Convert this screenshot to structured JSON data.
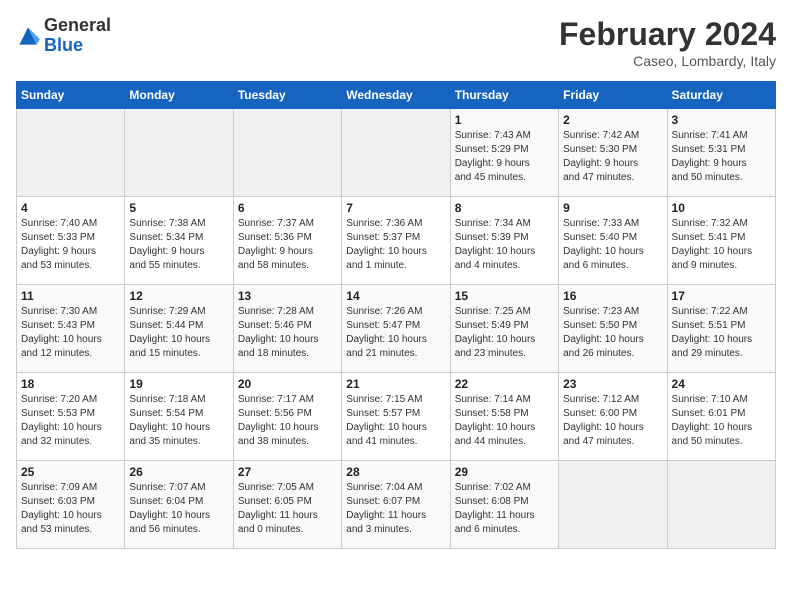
{
  "header": {
    "logo_general": "General",
    "logo_blue": "Blue",
    "month_title": "February 2024",
    "location": "Caseo, Lombardy, Italy"
  },
  "days_of_week": [
    "Sunday",
    "Monday",
    "Tuesday",
    "Wednesday",
    "Thursday",
    "Friday",
    "Saturday"
  ],
  "weeks": [
    [
      {
        "num": "",
        "info": ""
      },
      {
        "num": "",
        "info": ""
      },
      {
        "num": "",
        "info": ""
      },
      {
        "num": "",
        "info": ""
      },
      {
        "num": "1",
        "info": "Sunrise: 7:43 AM\nSunset: 5:29 PM\nDaylight: 9 hours\nand 45 minutes."
      },
      {
        "num": "2",
        "info": "Sunrise: 7:42 AM\nSunset: 5:30 PM\nDaylight: 9 hours\nand 47 minutes."
      },
      {
        "num": "3",
        "info": "Sunrise: 7:41 AM\nSunset: 5:31 PM\nDaylight: 9 hours\nand 50 minutes."
      }
    ],
    [
      {
        "num": "4",
        "info": "Sunrise: 7:40 AM\nSunset: 5:33 PM\nDaylight: 9 hours\nand 53 minutes."
      },
      {
        "num": "5",
        "info": "Sunrise: 7:38 AM\nSunset: 5:34 PM\nDaylight: 9 hours\nand 55 minutes."
      },
      {
        "num": "6",
        "info": "Sunrise: 7:37 AM\nSunset: 5:36 PM\nDaylight: 9 hours\nand 58 minutes."
      },
      {
        "num": "7",
        "info": "Sunrise: 7:36 AM\nSunset: 5:37 PM\nDaylight: 10 hours\nand 1 minute."
      },
      {
        "num": "8",
        "info": "Sunrise: 7:34 AM\nSunset: 5:39 PM\nDaylight: 10 hours\nand 4 minutes."
      },
      {
        "num": "9",
        "info": "Sunrise: 7:33 AM\nSunset: 5:40 PM\nDaylight: 10 hours\nand 6 minutes."
      },
      {
        "num": "10",
        "info": "Sunrise: 7:32 AM\nSunset: 5:41 PM\nDaylight: 10 hours\nand 9 minutes."
      }
    ],
    [
      {
        "num": "11",
        "info": "Sunrise: 7:30 AM\nSunset: 5:43 PM\nDaylight: 10 hours\nand 12 minutes."
      },
      {
        "num": "12",
        "info": "Sunrise: 7:29 AM\nSunset: 5:44 PM\nDaylight: 10 hours\nand 15 minutes."
      },
      {
        "num": "13",
        "info": "Sunrise: 7:28 AM\nSunset: 5:46 PM\nDaylight: 10 hours\nand 18 minutes."
      },
      {
        "num": "14",
        "info": "Sunrise: 7:26 AM\nSunset: 5:47 PM\nDaylight: 10 hours\nand 21 minutes."
      },
      {
        "num": "15",
        "info": "Sunrise: 7:25 AM\nSunset: 5:49 PM\nDaylight: 10 hours\nand 23 minutes."
      },
      {
        "num": "16",
        "info": "Sunrise: 7:23 AM\nSunset: 5:50 PM\nDaylight: 10 hours\nand 26 minutes."
      },
      {
        "num": "17",
        "info": "Sunrise: 7:22 AM\nSunset: 5:51 PM\nDaylight: 10 hours\nand 29 minutes."
      }
    ],
    [
      {
        "num": "18",
        "info": "Sunrise: 7:20 AM\nSunset: 5:53 PM\nDaylight: 10 hours\nand 32 minutes."
      },
      {
        "num": "19",
        "info": "Sunrise: 7:18 AM\nSunset: 5:54 PM\nDaylight: 10 hours\nand 35 minutes."
      },
      {
        "num": "20",
        "info": "Sunrise: 7:17 AM\nSunset: 5:56 PM\nDaylight: 10 hours\nand 38 minutes."
      },
      {
        "num": "21",
        "info": "Sunrise: 7:15 AM\nSunset: 5:57 PM\nDaylight: 10 hours\nand 41 minutes."
      },
      {
        "num": "22",
        "info": "Sunrise: 7:14 AM\nSunset: 5:58 PM\nDaylight: 10 hours\nand 44 minutes."
      },
      {
        "num": "23",
        "info": "Sunrise: 7:12 AM\nSunset: 6:00 PM\nDaylight: 10 hours\nand 47 minutes."
      },
      {
        "num": "24",
        "info": "Sunrise: 7:10 AM\nSunset: 6:01 PM\nDaylight: 10 hours\nand 50 minutes."
      }
    ],
    [
      {
        "num": "25",
        "info": "Sunrise: 7:09 AM\nSunset: 6:03 PM\nDaylight: 10 hours\nand 53 minutes."
      },
      {
        "num": "26",
        "info": "Sunrise: 7:07 AM\nSunset: 6:04 PM\nDaylight: 10 hours\nand 56 minutes."
      },
      {
        "num": "27",
        "info": "Sunrise: 7:05 AM\nSunset: 6:05 PM\nDaylight: 11 hours\nand 0 minutes."
      },
      {
        "num": "28",
        "info": "Sunrise: 7:04 AM\nSunset: 6:07 PM\nDaylight: 11 hours\nand 3 minutes."
      },
      {
        "num": "29",
        "info": "Sunrise: 7:02 AM\nSunset: 6:08 PM\nDaylight: 11 hours\nand 6 minutes."
      },
      {
        "num": "",
        "info": ""
      },
      {
        "num": "",
        "info": ""
      }
    ]
  ]
}
